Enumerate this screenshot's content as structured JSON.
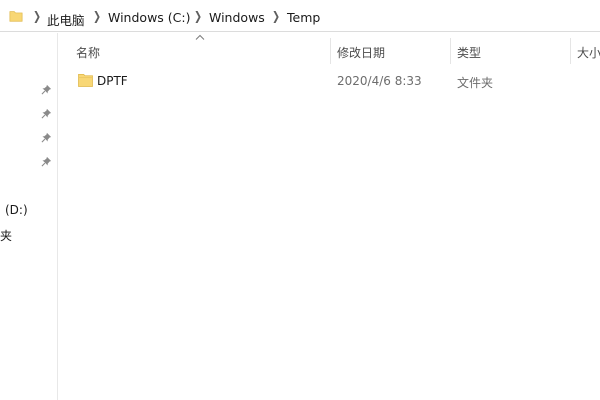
{
  "address_bar": {
    "breadcrumbs": [
      "此电脑",
      "Windows (C:)",
      "Windows",
      "Temp"
    ],
    "folder_icon": "folder-icon",
    "separator_icon": "chevron-right-icon"
  },
  "nav_pane": {
    "pin_icon": "pin-icon",
    "items": [
      "(D:)",
      "夹"
    ]
  },
  "columns": {
    "name": "名称",
    "modified": "修改日期",
    "type": "类型",
    "size": "大小"
  },
  "files": [
    {
      "name": "DPTF",
      "modified": "2020/4/6 8:33",
      "type": "文件夹",
      "icon": "folder-icon"
    }
  ],
  "colors": {
    "folder_yellow": "#f8d775",
    "folder_dark": "#e0b84a",
    "pin": "#8a8a8a"
  }
}
